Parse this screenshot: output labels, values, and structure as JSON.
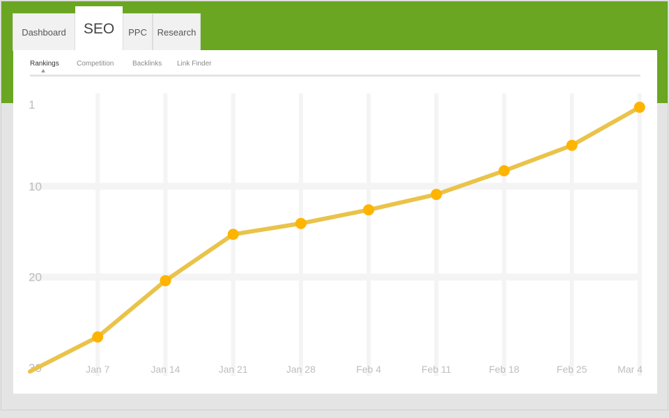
{
  "tabs": [
    {
      "label": "Dashboard",
      "active": false
    },
    {
      "label": "SEO",
      "active": true
    },
    {
      "label": "PPC",
      "active": false
    },
    {
      "label": "Research",
      "active": false
    }
  ],
  "subnav": [
    {
      "label": "Rankings",
      "active": true
    },
    {
      "label": "Competition",
      "active": false
    },
    {
      "label": "Backlinks",
      "active": false
    },
    {
      "label": "Link Finder",
      "active": false
    }
  ],
  "colors": {
    "brand_green": "#6aa622",
    "line": "#e9c34a",
    "marker": "#ffb400"
  },
  "chart_data": {
    "type": "line",
    "title": "",
    "xlabel": "",
    "ylabel": "",
    "y_inverted": true,
    "ylim": [
      30,
      1
    ],
    "y_ticks": [
      1,
      10,
      20,
      30
    ],
    "x_tick_labels": [
      "Jan 7",
      "Jan 14",
      "Jan 21",
      "Jan 28",
      "Feb 4",
      "Feb 11",
      "Feb 18",
      "Feb 25",
      "Mar 4"
    ],
    "grid": true,
    "series": [
      {
        "x": [
          "Dec 31",
          "Jan 7",
          "Jan 14",
          "Jan 21",
          "Jan 28",
          "Feb 4",
          "Feb 11",
          "Feb 18",
          "Feb 25",
          "Mar 4"
        ],
        "values": [
          30.4,
          26.6,
          20.4,
          15.3,
          14.1,
          12.6,
          10.9,
          8.3,
          5.5,
          1.3
        ]
      }
    ]
  }
}
